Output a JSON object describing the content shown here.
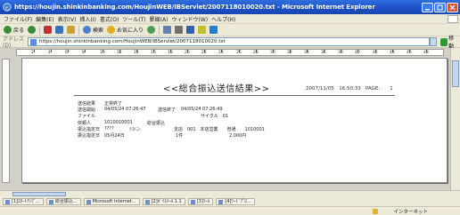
{
  "window": {
    "title": "https://houjin.shinkinbanking.com/HoujinWEB/IBServlet/2007118010020.txt - Microsoft Internet Explorer"
  },
  "menu": [
    "ファイル(F)",
    "編集(E)",
    "表示(V)",
    "挿入(I)",
    "書式(O)",
    "ツール(T)",
    "罫線(A)",
    "ウィンドウ(W)",
    "ヘルプ(H)"
  ],
  "toolbar": {
    "back_label": "戻る",
    "search_label": "検索",
    "favorites_label": "お気に入り"
  },
  "address": {
    "label": "アドレス(D)",
    "url": "https://houjin.shinkinbanking.com/HoujinWEB/IBServlet/2007118010020.txt",
    "go_label": "移動"
  },
  "ruler": [
    "2",
    "4",
    "6",
    "8",
    "10",
    "12",
    "14",
    "16",
    "18",
    "20",
    "22",
    "24",
    "26",
    "28",
    "30",
    "32",
    "34",
    "36",
    "38",
    "40",
    "42",
    "44",
    "46",
    "48"
  ],
  "document": {
    "title": "<<総合振込送信結果>>",
    "date": "2007/11/05　16:50:33",
    "page": "PAGE:　　1",
    "rows": [
      {
        "a": "送信結果",
        "b": "正常終了",
        "c": "",
        "d": ""
      },
      {
        "a": "送信開始",
        "b": "04/05/24 07:26:47",
        "c": "送信終了",
        "d": "04/05/24 07:26:49"
      },
      {
        "a": "ファイル",
        "b": "",
        "c": "",
        "d": "サイクル　01"
      },
      {
        "a": "依頼人",
        "b": "1010010001",
        "c": "総合振込",
        "d": ""
      },
      {
        "a": "振込指定日",
        "b": "????",
        "c": "ﾃｽﾄﾆﾝ",
        "d": "支店　001　本店営業　　普通　　1010001"
      },
      {
        "a": "振込指定日",
        "b": "05月24日",
        "c": "1件",
        "d": "2,000円"
      }
    ]
  },
  "tabs": [
    "[1]ｽﾀｰﾄｱｯﾌﾟ...",
    "総合振込...",
    "Microsoft Internet...",
    "[2]ﾎﾞｲｽﾒｰﾙ 1.1",
    "[3]ﾂｰﾙ",
    "[4]ﾜｰﾄﾞﾌﾟﾛ..."
  ],
  "status": {
    "zone": "インターネット"
  }
}
